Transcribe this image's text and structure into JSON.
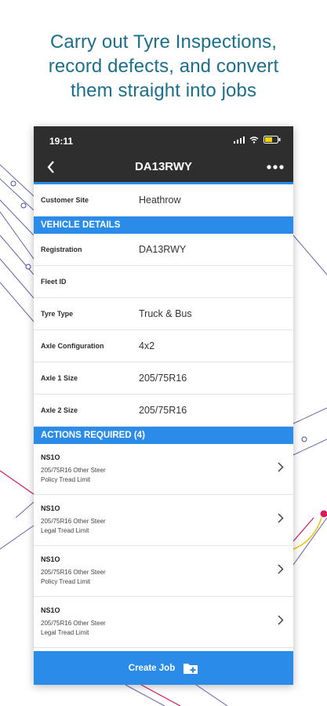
{
  "headline": {
    "line1": "Carry out Tyre Inspections,",
    "line2": "record defects, and convert",
    "line3": "them straight into jobs"
  },
  "status_bar": {
    "time": "19:11"
  },
  "nav": {
    "title": "DA13RWY"
  },
  "customer": {
    "label": "Customer Site",
    "value": "Heathrow"
  },
  "vehicle_section": {
    "title": "VEHICLE DETAILS",
    "rows": [
      {
        "label": "Registration",
        "value": "DA13RWY"
      },
      {
        "label": "Fleet ID",
        "value": ""
      },
      {
        "label": "Tyre Type",
        "value": "Truck & Bus"
      },
      {
        "label": "Axle Configuration",
        "value": "4x2"
      },
      {
        "label": "Axle 1 Size",
        "value": "205/75R16"
      },
      {
        "label": "Axle 2 Size",
        "value": "205/75R16"
      }
    ]
  },
  "actions_section": {
    "title": "ACTIONS REQUIRED (4)",
    "items": [
      {
        "code": "NS1O",
        "line1": "205/75R16 Other Steer",
        "line2": "Policy Tread Limit"
      },
      {
        "code": "NS1O",
        "line1": "205/75R16 Other Steer",
        "line2": "Legal Tread Limit"
      },
      {
        "code": "NS1O",
        "line1": "205/75R16 Other Steer",
        "line2": "Policy Tread Limit"
      },
      {
        "code": "NS1O",
        "line1": "205/75R16 Other Steer",
        "line2": "Legal Tread Limit"
      }
    ]
  },
  "footer": {
    "create_job_label": "Create Job",
    "icon": "folder-plus-icon"
  },
  "colors": {
    "accent": "#2a8ce8",
    "app_bar": "#2e2e2e",
    "headline": "#1c6f8c"
  }
}
